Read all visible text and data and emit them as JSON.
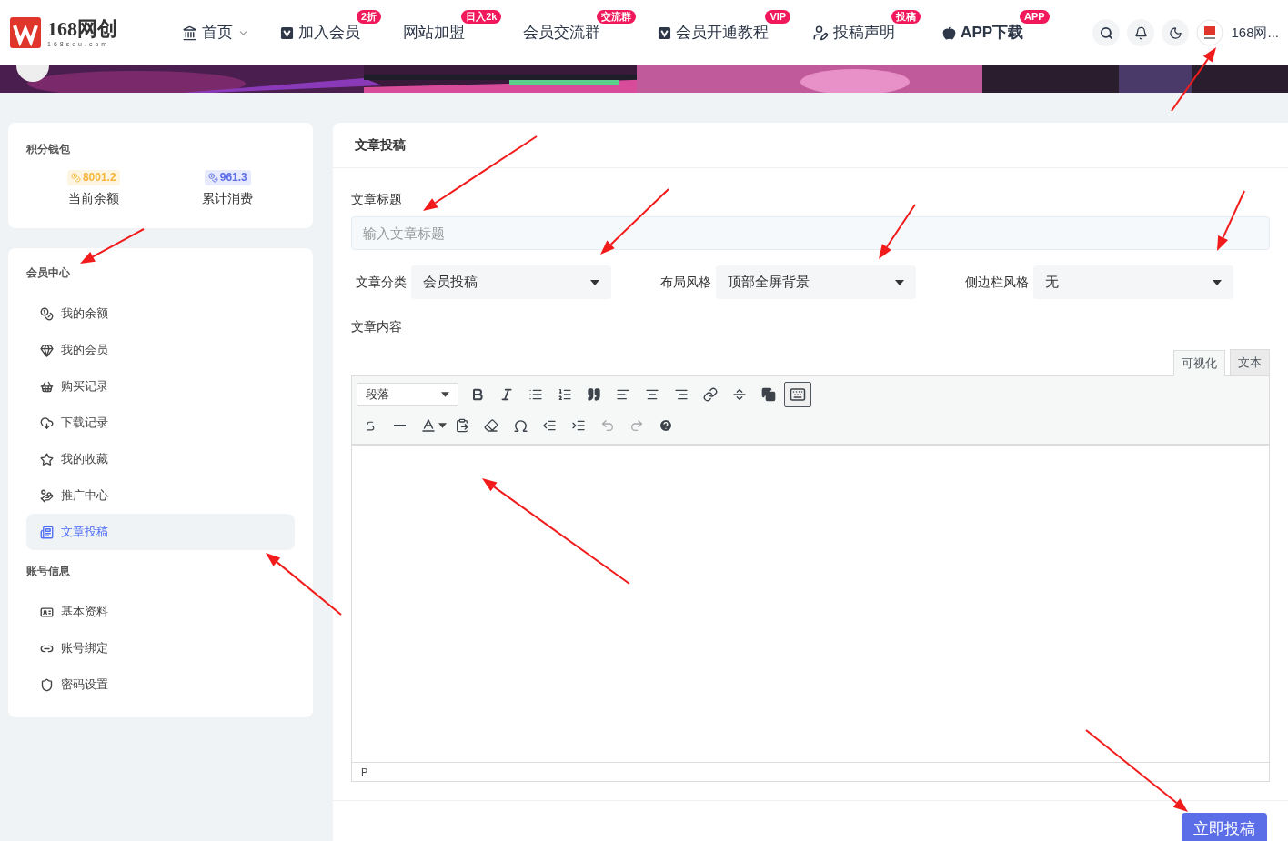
{
  "logo": {
    "title": "168网创",
    "domain": "168sou.com"
  },
  "nav": [
    {
      "label": "首页",
      "dropdown": true
    },
    {
      "label": "加入会员",
      "badge": "2折",
      "dropdown": false
    },
    {
      "label": "网站加盟",
      "badge": "日入2k",
      "dropdown": false
    },
    {
      "label": "会员交流群",
      "badge": "交流群",
      "dropdown": false
    },
    {
      "label": "会员开通教程",
      "badge": "VIP",
      "dropdown": false
    },
    {
      "label": "投稿声明",
      "badge": "投稿",
      "dropdown": false
    },
    {
      "label": "APP下载",
      "badge": "APP",
      "dropdown": false
    }
  ],
  "user": {
    "name": "168网..."
  },
  "wallet": {
    "title": "积分钱包",
    "stats": [
      {
        "value": "8001.2",
        "label": "当前余额",
        "color": "#f5b73b"
      },
      {
        "value": "961.3",
        "label": "累计消费",
        "color": "#5b6ee8"
      }
    ]
  },
  "sections": [
    {
      "title": "会员中心",
      "items": [
        {
          "label": "我的余额",
          "selected": false
        },
        {
          "label": "我的会员",
          "selected": false
        },
        {
          "label": "购买记录",
          "selected": false
        },
        {
          "label": "下载记录",
          "selected": false
        },
        {
          "label": "我的收藏",
          "selected": false
        },
        {
          "label": "推广中心",
          "selected": false
        },
        {
          "label": "文章投稿",
          "selected": true
        }
      ]
    },
    {
      "title": "账号信息",
      "items": [
        {
          "label": "基本资料",
          "selected": false
        },
        {
          "label": "账号绑定",
          "selected": false
        },
        {
          "label": "密码设置",
          "selected": false
        }
      ]
    }
  ],
  "form": {
    "title": "文章投稿",
    "title_label": "文章标题",
    "title_placeholder": "输入文章标题",
    "selects": [
      {
        "label": "文章分类",
        "value": "会员投稿"
      },
      {
        "label": "布局风格",
        "value": "顶部全屏背景"
      },
      {
        "label": "侧边栏风格",
        "value": "无"
      }
    ],
    "content_label": "文章内容",
    "editor_tabs": [
      {
        "label": "可视化",
        "selected": true
      },
      {
        "label": "文本",
        "selected": false
      }
    ],
    "editor": {
      "format": "段落",
      "kitchen_sink_on": true,
      "undo_disabled": true,
      "redo_disabled": true,
      "path": "P"
    },
    "submit": "立即投稿"
  }
}
